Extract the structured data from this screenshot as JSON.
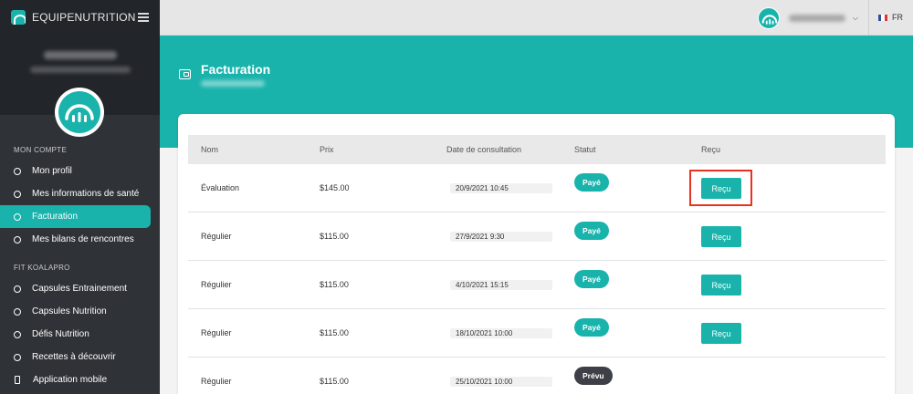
{
  "app": {
    "brand": "EQUIPENUTRITION",
    "accent_color": "#19b3ac"
  },
  "sidebar": {
    "sections": [
      {
        "title": "MON COMPTE",
        "items": [
          {
            "label": "Mon profil",
            "icon": "circle-icon",
            "active": false
          },
          {
            "label": "Mes informations de santé",
            "icon": "circle-icon",
            "active": false
          },
          {
            "label": "Facturation",
            "icon": "circle-icon",
            "active": true
          },
          {
            "label": "Mes bilans de rencontres",
            "icon": "circle-icon",
            "active": false
          }
        ]
      },
      {
        "title": "FIT KOALAPRO",
        "items": [
          {
            "label": "Capsules Entrainement",
            "icon": "circle-icon",
            "active": false
          },
          {
            "label": "Capsules Nutrition",
            "icon": "circle-icon",
            "active": false
          },
          {
            "label": "Défis Nutrition",
            "icon": "circle-icon",
            "active": false
          },
          {
            "label": "Recettes à découvrir",
            "icon": "circle-icon",
            "active": false
          },
          {
            "label": "Application mobile",
            "icon": "mobile-phone-icon",
            "active": false
          }
        ]
      }
    ]
  },
  "header": {
    "language": "FR"
  },
  "page": {
    "title": "Facturation"
  },
  "table": {
    "columns": [
      "Nom",
      "Prix",
      "Date de consultation",
      "Statut",
      "Reçu"
    ],
    "rows": [
      {
        "name": "Évaluation",
        "price": "$145.00",
        "date": "20/9/2021 10:45",
        "status": "Payé",
        "receipt": "Reçu"
      },
      {
        "name": "Régulier",
        "price": "$115.00",
        "date": "27/9/2021 9:30",
        "status": "Payé",
        "receipt": "Reçu"
      },
      {
        "name": "Régulier",
        "price": "$115.00",
        "date": "4/10/2021 15:15",
        "status": "Payé",
        "receipt": "Reçu"
      },
      {
        "name": "Régulier",
        "price": "$115.00",
        "date": "18/10/2021 10:00",
        "status": "Payé",
        "receipt": "Reçu"
      },
      {
        "name": "Régulier",
        "price": "$115.00",
        "date": "25/10/2021 10:00",
        "status": "Prévu",
        "receipt": ""
      }
    ]
  }
}
